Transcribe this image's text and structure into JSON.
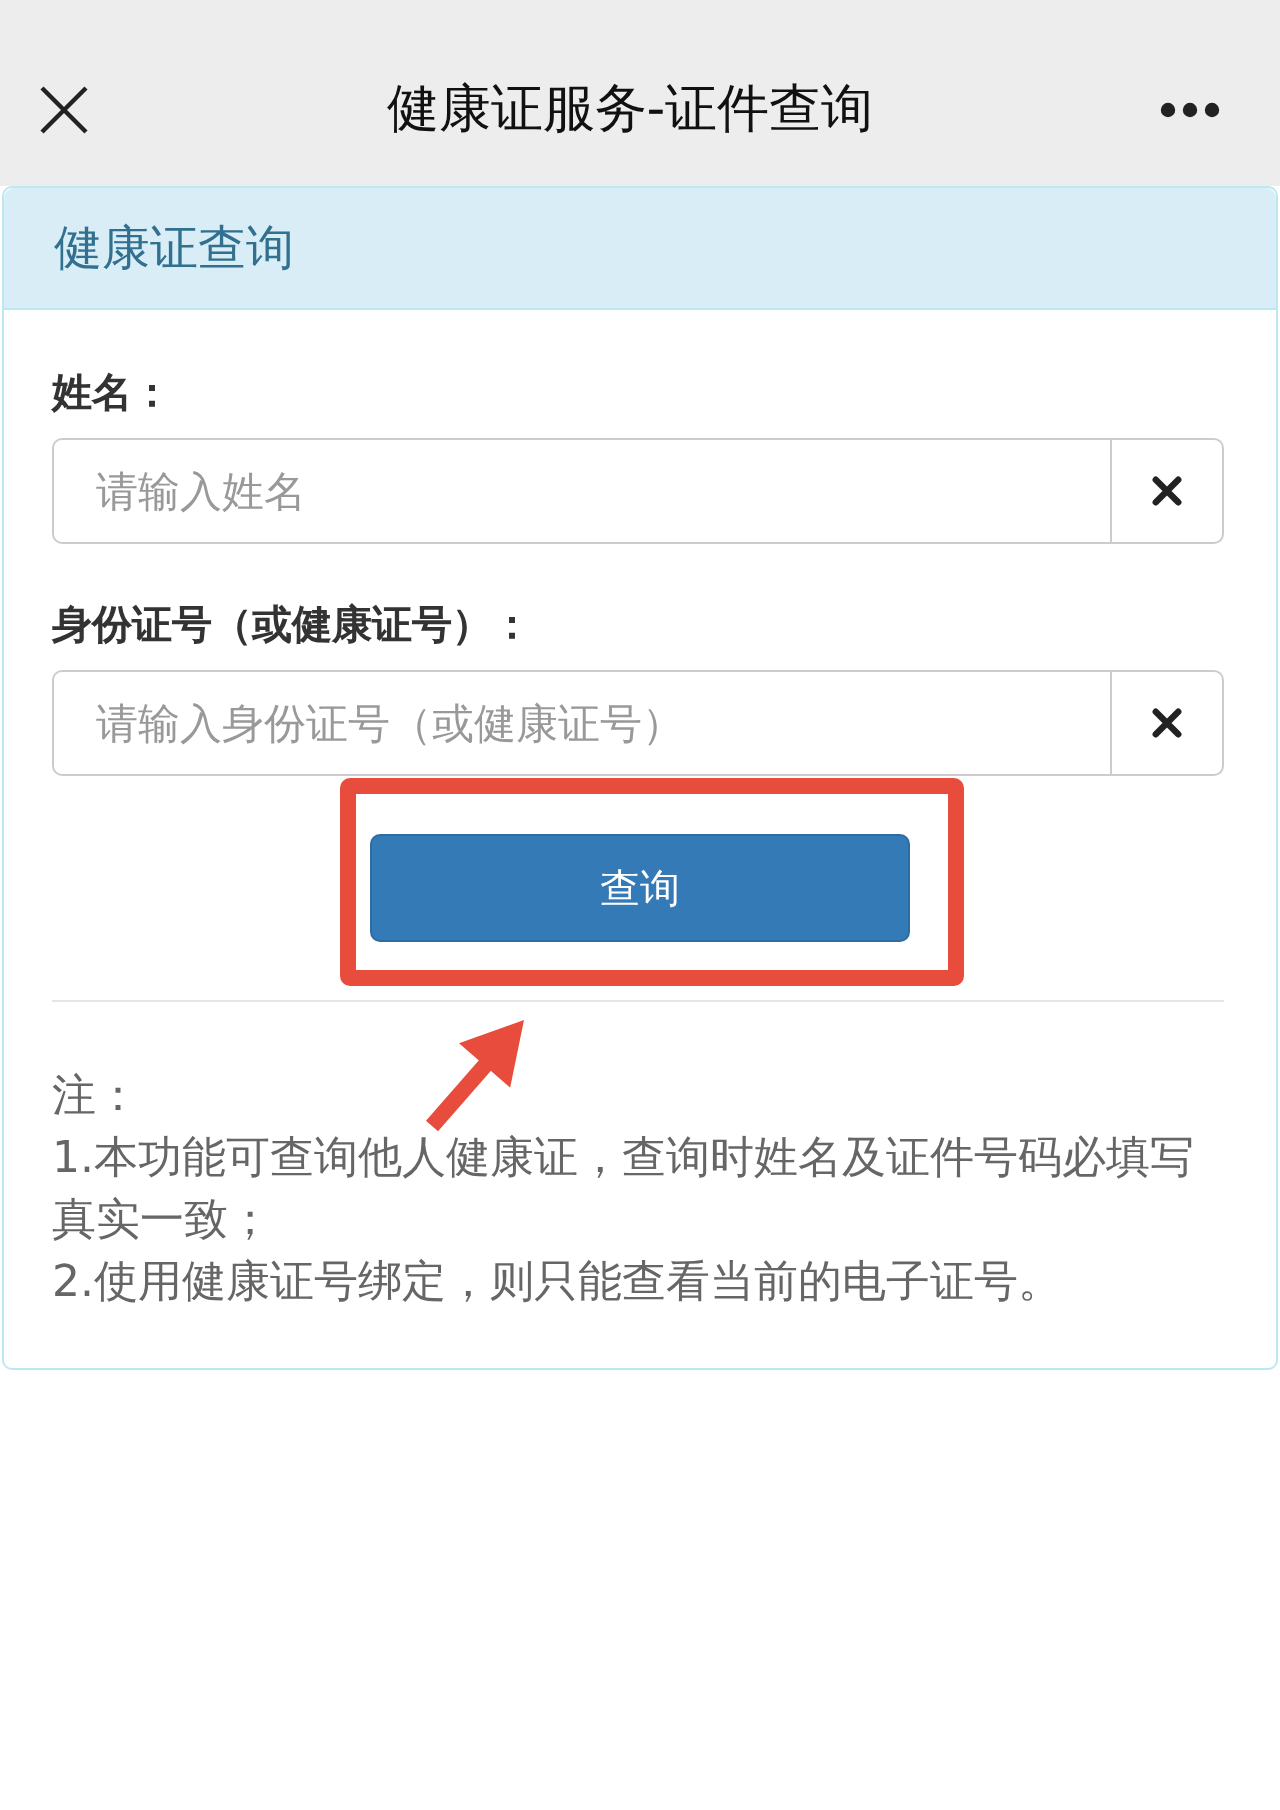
{
  "nav_bar": {
    "title": "健康证服务-证件查询"
  },
  "panel": {
    "heading": "健康证查询",
    "fields": [
      {
        "label": "姓名：",
        "placeholder": "请输入姓名"
      },
      {
        "label": "身份证号（或健康证号）：",
        "placeholder": "请输入身份证号（或健康证号）"
      }
    ],
    "submit_button": {
      "label": "查询",
      "highlighted": true
    },
    "note": {
      "title": "注：",
      "lines": [
        "1.本功能可查询他人健康证，查询时姓名及证件号码必填写真实一致；",
        "2.使用健康证号绑定，则只能查看当前的电子证号。"
      ]
    }
  }
}
